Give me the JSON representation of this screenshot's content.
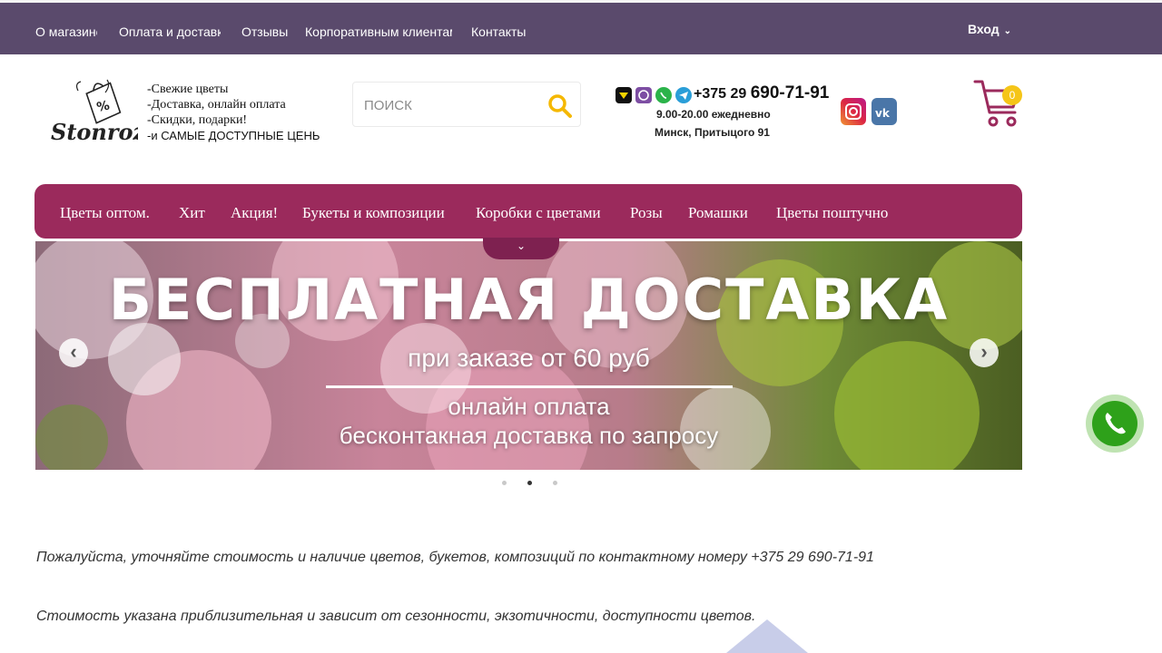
{
  "topnav": {
    "items": [
      {
        "label": "О магазине"
      },
      {
        "label": "Оплата и доставка"
      },
      {
        "label": "Отзывы"
      },
      {
        "label": "Корпоративным клиентам"
      },
      {
        "label": "Контакты"
      }
    ],
    "login_label": "Вход"
  },
  "header": {
    "logo_text": "Stonroz",
    "tagline": [
      "-Свежие цветы",
      "-Доставка, онлайн оплата",
      "-Скидки, подарки!",
      "-и САМЫЕ ДОСТУПНЫЕ ЦЕНЫ"
    ],
    "search": {
      "placeholder": "ПОИСК"
    },
    "contacts": {
      "phone_prefix": "+375 29",
      "phone_number": "690-71-91",
      "hours": "9.00-20.00 ежедневно",
      "address": "Минск, Притыцого 91",
      "messengers": [
        "velcom-icon",
        "viber-icon",
        "whatsapp-icon",
        "telegram-icon"
      ]
    },
    "social": [
      "instagram-icon",
      "vk-icon"
    ],
    "cart_count": "0"
  },
  "catnav": {
    "items": [
      {
        "label": "Цветы оптом."
      },
      {
        "label": "Хит"
      },
      {
        "label": "Акция!"
      },
      {
        "label": "Букеты и композиции"
      },
      {
        "label": "Коробки с цветами"
      },
      {
        "label": "Розы"
      },
      {
        "label": "Ромашки"
      },
      {
        "label": "Цветы поштучно"
      }
    ]
  },
  "banner": {
    "title": "БЕСПЛАТНАЯ ДОСТАВКА",
    "subtitle": "при заказе от 60 руб",
    "line2": "онлайн оплата",
    "line3": "бесконтакная доставка по запросу",
    "slides": 3,
    "active_slide": 2
  },
  "notes": {
    "line1": "Пожалуйста, уточняйте стоимость и наличие цветов, букетов, композиций по контактному номеру  +375 29 690-71-91",
    "line2": "Стоимость указана приблизительная и зависит от сезонности, экзотичности, доступности цветов."
  },
  "colors": {
    "topbar": "#5a4a6c",
    "catnav": "#9b2a5c",
    "search_icon": "#f5b800",
    "cart": "#9b2a5c",
    "call_button": "#2ea11a"
  }
}
